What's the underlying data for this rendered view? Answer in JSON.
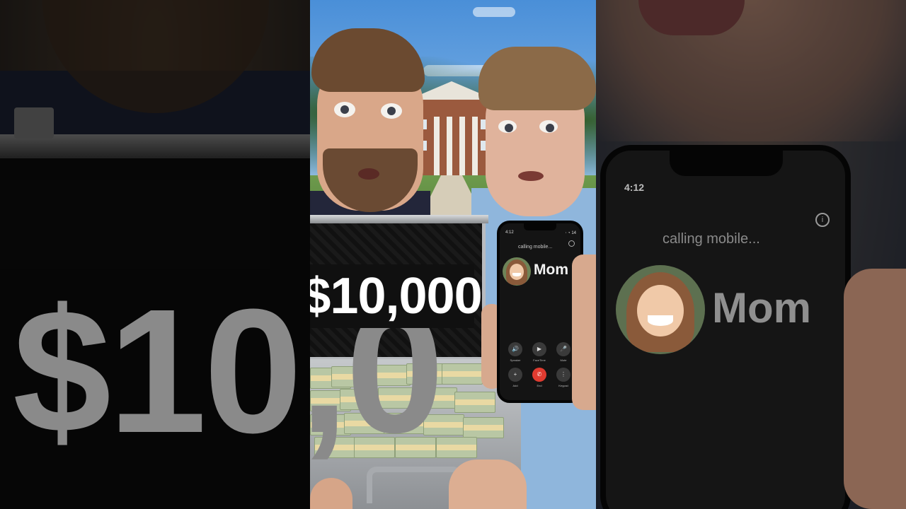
{
  "thumbnail": {
    "amount_label": "$10,000",
    "amount_blur_label": "$10,0",
    "phone_time": "4:12",
    "phone_status": "⋅ ◔ 14",
    "call_status": "calling mobile...",
    "contact_name": "Mom",
    "call_buttons": [
      {
        "icon": "speaker-icon",
        "glyph": "🔊",
        "label": "Speaker"
      },
      {
        "icon": "facetime-icon",
        "glyph": "▶",
        "label": "FaceTime"
      },
      {
        "icon": "mute-icon",
        "glyph": "🎤",
        "label": "Mute"
      },
      {
        "icon": "add-icon",
        "glyph": "+",
        "label": "Add"
      },
      {
        "icon": "end-call-icon",
        "glyph": "✆",
        "label": "End"
      },
      {
        "icon": "keypad-icon",
        "glyph": "⋮",
        "label": "Keypad"
      }
    ],
    "colors": {
      "end_call": "#e03b30",
      "label_bg": "#101010",
      "sky": "#4a8fd8",
      "shirt_right": "#8fb6dc"
    }
  }
}
